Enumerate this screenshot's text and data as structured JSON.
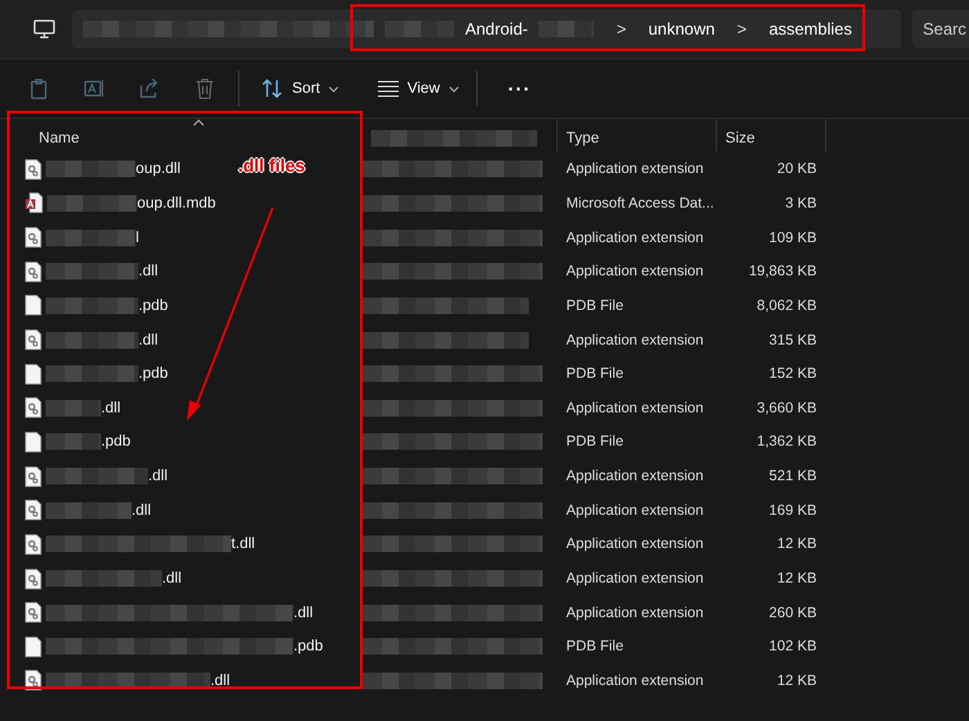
{
  "address_bar": {
    "crumbs": [
      {
        "label": "Android-"
      },
      {
        "label": "unknown"
      },
      {
        "label": "assemblies"
      }
    ],
    "separator": ">"
  },
  "search": {
    "label": "Searc"
  },
  "toolbar": {
    "sort": "Sort",
    "view": "View",
    "more": "···"
  },
  "columns": {
    "name": "Name",
    "type": "Type",
    "size": "Size"
  },
  "rows": [
    {
      "kind": "dll",
      "name": "oup.dll",
      "type": "Application extension",
      "size": "20 KB"
    },
    {
      "kind": "mdb",
      "name": "oup.dll.mdb",
      "type": "Microsoft Access Dat...",
      "size": "3 KB"
    },
    {
      "kind": "dll",
      "name": "l",
      "type": "Application extension",
      "size": "109 KB"
    },
    {
      "kind": "dll",
      "name": ".dll",
      "type": "Application extension",
      "size": "19,863 KB"
    },
    {
      "kind": "pdb",
      "name": ".pdb",
      "type": "PDB File",
      "size": "8,062 KB"
    },
    {
      "kind": "dll",
      "name": ".dll",
      "type": "Application extension",
      "size": "315 KB"
    },
    {
      "kind": "pdb",
      "name": ".pdb",
      "type": "PDB File",
      "size": "152 KB"
    },
    {
      "kind": "dll",
      "name": ".dll",
      "type": "Application extension",
      "size": "3,660 KB"
    },
    {
      "kind": "pdb",
      "name": ".pdb",
      "type": "PDB File",
      "size": "1,362 KB"
    },
    {
      "kind": "dll",
      "name": ".dll",
      "type": "Application extension",
      "size": "521 KB"
    },
    {
      "kind": "dll",
      "name": ".dll",
      "type": "Application extension",
      "size": "169 KB"
    },
    {
      "kind": "dll",
      "name": "t.dll",
      "type": "Application extension",
      "size": "12 KB"
    },
    {
      "kind": "dll",
      "name": ".dll",
      "type": "Application extension",
      "size": "12 KB"
    },
    {
      "kind": "dll",
      "name": ".dll",
      "type": "Application extension",
      "size": "260 KB"
    },
    {
      "kind": "pdb",
      "name": ".pdb",
      "type": "PDB File",
      "size": "102 KB"
    },
    {
      "kind": "dll",
      "name": ".dll",
      "type": "Application extension",
      "size": "12 KB"
    }
  ],
  "annotation": {
    "label": ".dll files"
  }
}
